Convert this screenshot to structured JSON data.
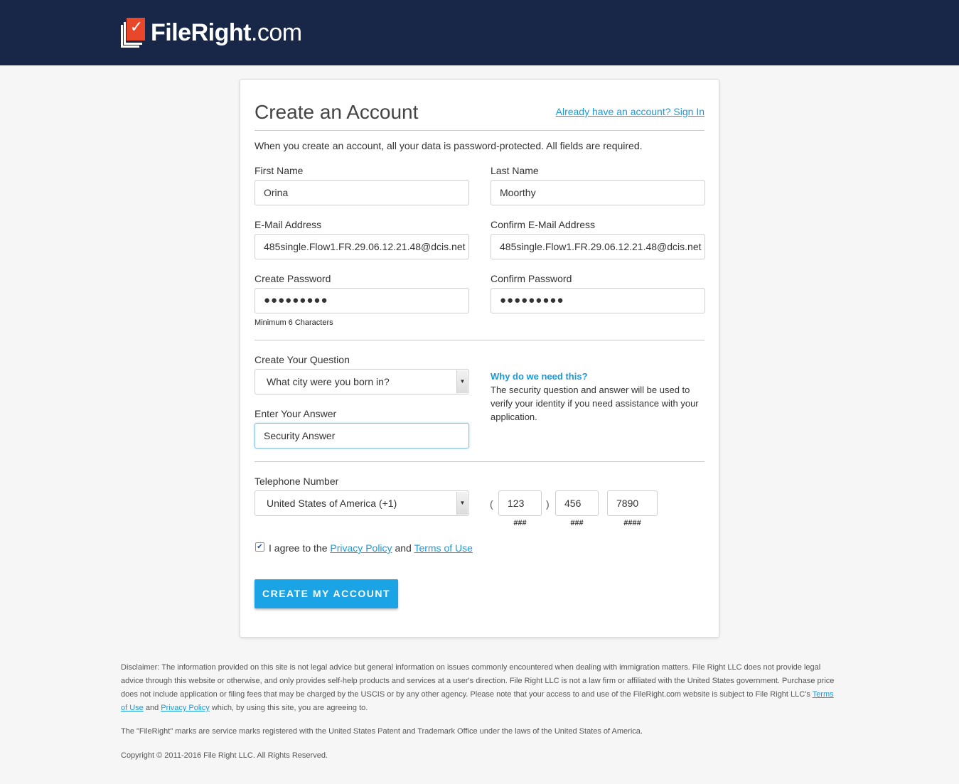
{
  "header": {
    "logo_text_bold": "FileRight",
    "logo_text_suffix": ".com"
  },
  "form": {
    "title": "Create an Account",
    "signin_link": "Already have an account? Sign In",
    "intro": "When you create an account, all your data is password-protected. All fields are required.",
    "first_name": {
      "label": "First Name",
      "value": "Orina"
    },
    "last_name": {
      "label": "Last Name",
      "value": "Moorthy"
    },
    "email": {
      "label": "E-Mail Address",
      "value": "485single.Flow1.FR.29.06.12.21.48@dcis.net"
    },
    "confirm_email": {
      "label": "Confirm E-Mail Address",
      "value": "485single.Flow1.FR.29.06.12.21.48@dcis.net"
    },
    "password": {
      "label": "Create Password",
      "value": "●●●●●●●●●",
      "hint": "Minimum 6 Characters"
    },
    "confirm_password": {
      "label": "Confirm Password",
      "value": "●●●●●●●●●"
    },
    "question": {
      "label": "Create Your Question",
      "selected": "What city were you born in?"
    },
    "answer": {
      "label": "Enter Your Answer",
      "value": "Security Answer"
    },
    "why": {
      "title": "Why do we need this?",
      "body": "The security question and answer will be used to verify your identity if you need assistance with your application."
    },
    "phone": {
      "label": "Telephone Number",
      "country": "United States of America (+1)",
      "open_paren": "(",
      "close_paren": ")",
      "area": "123",
      "prefix": "456",
      "line": "7890",
      "area_hint": "###",
      "prefix_hint": "###",
      "line_hint": "####"
    },
    "agree": {
      "checked": true,
      "check_glyph": "✔",
      "text_before": "I agree to the",
      "privacy": "Privacy Policy",
      "text_mid": "and",
      "terms": "Terms of Use"
    },
    "submit": "CREATE MY ACCOUNT"
  },
  "footer": {
    "disclaimer": "Disclaimer: The information provided on this site is not legal advice but general information on issues commonly encountered when dealing with immigration matters. File Right LLC does not provide legal advice through this website or otherwise, and only provides self-help products and services at a user's direction. File Right LLC is not a law firm or affiliated with the United States government. Purchase price does not include application or filing fees that may be charged by the USCIS or by any other agency. Please note that your access to and use of the FileRight.com website is subject to File Right LLC's",
    "terms_link": "Terms of Use",
    "and": "and",
    "privacy_link": "Privacy Policy",
    "disclaimer_end": "which, by using this site, you are agreeing to.",
    "marks": "The \"FileRight\" marks are service marks registered with the United States Patent and Trademark Office under the laws of the United States of America.",
    "copyright": "Copyright © 2011-2016 File Right LLC. All Rights Reserved."
  },
  "colors": {
    "header_bg": "#182647",
    "accent": "#1aa3e5",
    "logo_red": "#e8472a"
  }
}
